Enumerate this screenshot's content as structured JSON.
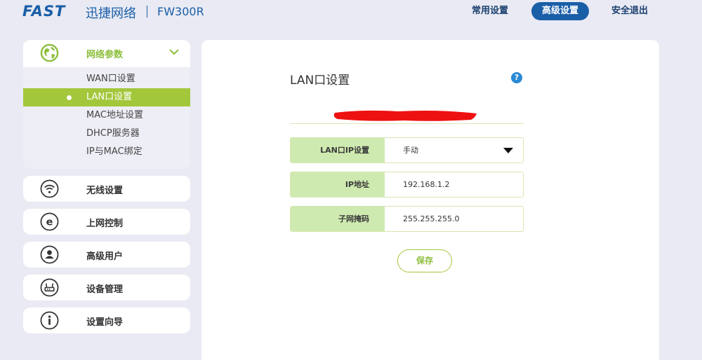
{
  "header": {
    "logo": "FAST",
    "brand": "迅捷网络",
    "model": "FW300R",
    "nav": [
      {
        "label": "常用设置"
      },
      {
        "label": "高级设置"
      },
      {
        "label": "安全退出"
      }
    ]
  },
  "sidebar": {
    "network": {
      "label": "网络参数",
      "icon": "globe-icon",
      "submenu": [
        {
          "label": "WAN口设置"
        },
        {
          "label": "LAN口设置"
        },
        {
          "label": "MAC地址设置"
        },
        {
          "label": "DHCP服务器"
        },
        {
          "label": "IP与MAC绑定"
        }
      ]
    },
    "items": [
      {
        "label": "无线设置",
        "icon": "wifi-icon"
      },
      {
        "label": "上网控制",
        "icon": "internet-control-icon"
      },
      {
        "label": "高级用户",
        "icon": "user-icon"
      },
      {
        "label": "设备管理",
        "icon": "router-icon"
      },
      {
        "label": "设置向导",
        "icon": "info-icon"
      }
    ]
  },
  "main": {
    "title": "LAN口设置",
    "help_icon": "?",
    "fields": [
      {
        "label": "LAN口IP设置",
        "value": "手动"
      },
      {
        "label": "IP地址",
        "value": "192.168.1.2"
      },
      {
        "label": "子网掩码",
        "value": "255.255.255.0"
      }
    ],
    "save_label": "保存"
  },
  "colors": {
    "brand": "#1a5ea8",
    "accent": "#a3c73b",
    "field_label_bg": "#cfeab0"
  }
}
